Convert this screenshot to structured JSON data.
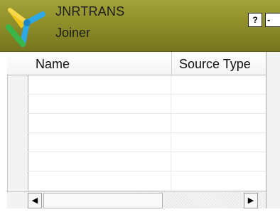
{
  "window": {
    "title": "JNRTRANS",
    "subtitle": "Joiner",
    "icon": "joiner-transformation-icon",
    "help_label": "?",
    "minimize_label": "-",
    "header_color": "#8f8f2a"
  },
  "grid": {
    "columns": [
      "Name",
      "Source Type"
    ],
    "rows": [
      {
        "name": "",
        "source_type": ""
      },
      {
        "name": "",
        "source_type": ""
      },
      {
        "name": "",
        "source_type": ""
      },
      {
        "name": "",
        "source_type": ""
      },
      {
        "name": "",
        "source_type": ""
      },
      {
        "name": "",
        "source_type": ""
      }
    ]
  },
  "scrollbar": {
    "left_arrow": "◀",
    "right_arrow": "▶"
  }
}
